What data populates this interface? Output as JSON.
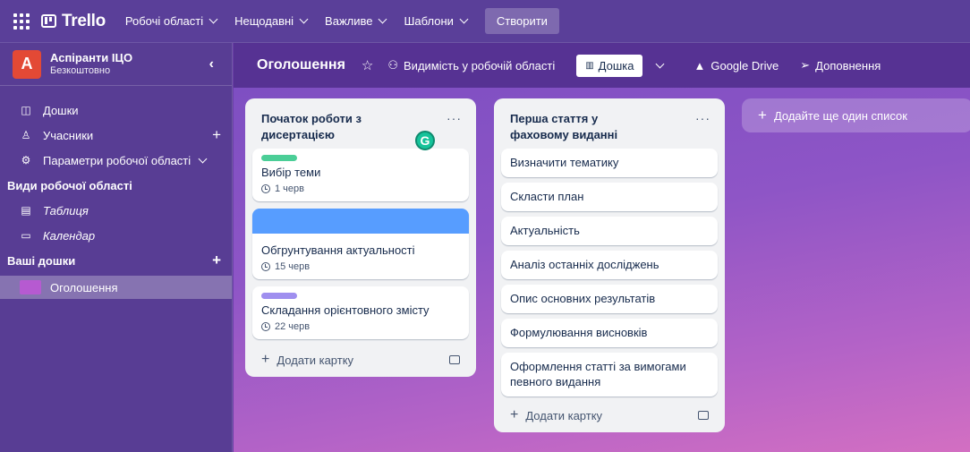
{
  "topbar": {
    "logo_text": "Trello",
    "nav": [
      "Робочі області",
      "Нещодавні",
      "Важливе",
      "Шаблони"
    ],
    "create_label": "Створити"
  },
  "sidebar": {
    "workspace_initial": "A",
    "workspace_name": "Аспіранти ІЦО",
    "workspace_plan": "Безкоштовно",
    "items": [
      "Дошки",
      "Учасники",
      "Параметри робочої області"
    ],
    "views_header": "Види робочої області",
    "views": [
      "Таблиця",
      "Календар"
    ],
    "boards_header": "Ваші дошки",
    "active_board": "Оголошення"
  },
  "boardbar": {
    "name": "Оголошення",
    "visibility": "Видимість у робочій області",
    "view": "Дошка",
    "powerups": [
      "Google Drive",
      "Доповнення"
    ]
  },
  "lists": [
    {
      "title": "Початок роботи з дисертацією",
      "cards": [
        {
          "title": "Вибір теми",
          "due": "1 черв"
        },
        {
          "title": "Обгрунтування актуальності",
          "due": "15 черв"
        },
        {
          "title": "Складання орієнтовного змісту",
          "due": "22 черв"
        }
      ],
      "add_label": "Додати картку"
    },
    {
      "title": "Перша стаття у фаховому виданні",
      "cards": [
        {
          "title": "Визначити тематику"
        },
        {
          "title": "Скласти план"
        },
        {
          "title": "Актуальність"
        },
        {
          "title": "Аналіз останніх досліджень"
        },
        {
          "title": "Опис основних результатів"
        },
        {
          "title": "Формулювання висновків"
        },
        {
          "title": "Оформлення статті за вимогами певного видання"
        }
      ],
      "add_label": "Додати картку"
    }
  ],
  "add_list_label": "Додайте ще один список",
  "grammarly_badge": "G",
  "colors": {
    "label_green": "#4bce97",
    "cover_blue": "#579dff",
    "label_purple": "#9f8fef",
    "avatar_red": "#e34935"
  }
}
